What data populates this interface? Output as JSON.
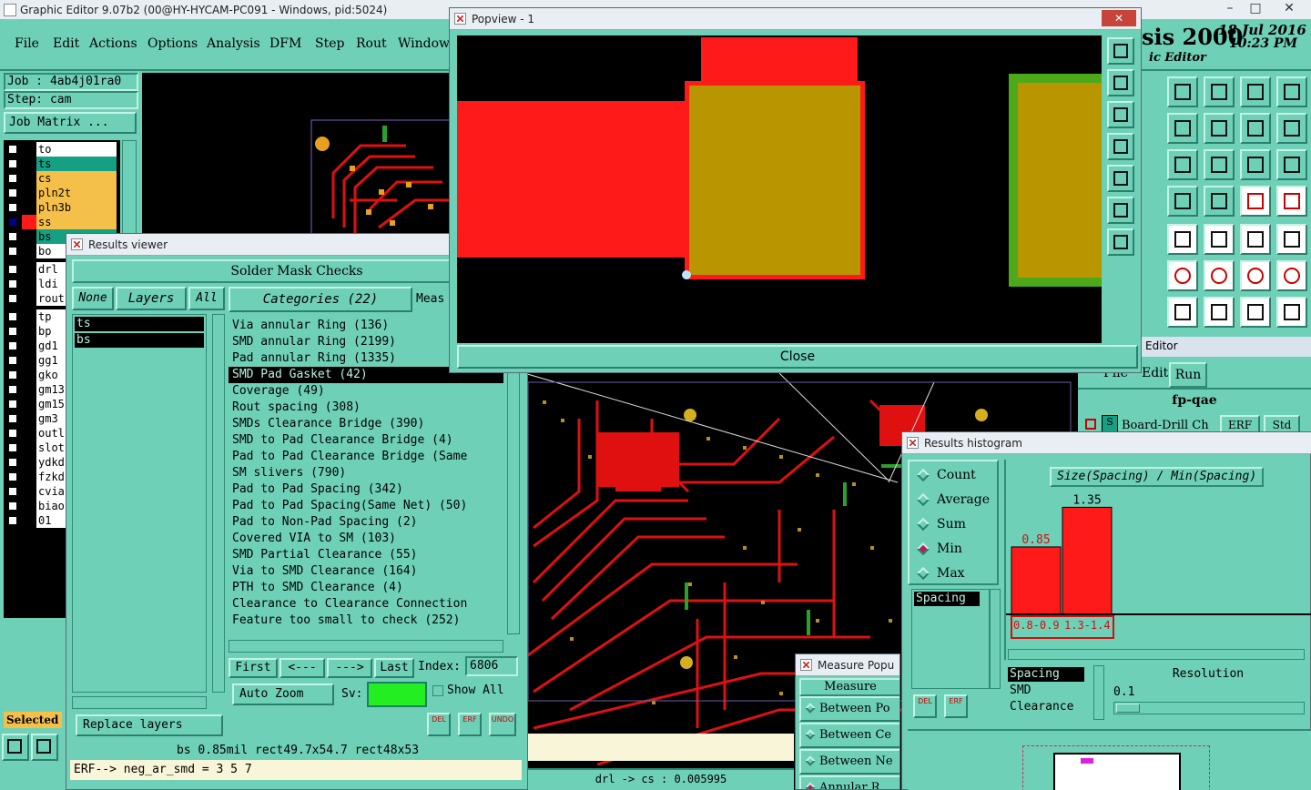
{
  "main_window": {
    "title": "Graphic Editor 9.07b2 (00@HY-HYCAM-PC091 - Windows, pid:5024)",
    "menu": [
      "File",
      "Edit",
      "Actions",
      "Options",
      "Analysis",
      "DFM",
      "Step",
      "Rout",
      "Windows"
    ],
    "job_label": "Job : 4ab4j01ra0",
    "step_label": "Step: cam",
    "job_matrix_button": "Job Matrix ...",
    "layers": [
      {
        "name": "to",
        "color": "#ffffff",
        "checked": false
      },
      {
        "name": "ts",
        "color": "#159f83",
        "checked": false
      },
      {
        "name": "cs",
        "color": "#f5c04a",
        "checked": false
      },
      {
        "name": "pln2t",
        "color": "#f5c04a",
        "checked": false
      },
      {
        "name": "pln3b",
        "color": "#f5c04a",
        "checked": false
      },
      {
        "name": "ss",
        "color": "#f5c04a",
        "checked": true
      },
      {
        "name": "bs",
        "color": "#159f83",
        "checked": false
      },
      {
        "name": "bo",
        "color": "#ffffff",
        "checked": false
      },
      {
        "name": "drl",
        "color": "#ffffff",
        "checked": false
      },
      {
        "name": "ldi",
        "color": "#ffffff",
        "checked": false
      },
      {
        "name": "rout",
        "color": "#ffffff",
        "checked": false
      },
      {
        "name": "tp",
        "color": "#ffffff",
        "checked": false
      },
      {
        "name": "bp",
        "color": "#ffffff",
        "checked": false
      },
      {
        "name": "gd1",
        "color": "#ffffff",
        "checked": false
      },
      {
        "name": "gg1",
        "color": "#ffffff",
        "checked": false
      },
      {
        "name": "gko",
        "color": "#ffffff",
        "checked": false
      },
      {
        "name": "gm13",
        "color": "#ffffff",
        "checked": false
      },
      {
        "name": "gm15",
        "color": "#ffffff",
        "checked": false
      },
      {
        "name": "gm3",
        "color": "#ffffff",
        "checked": false
      },
      {
        "name": "outl",
        "color": "#ffffff",
        "checked": false
      },
      {
        "name": "slot",
        "color": "#ffffff",
        "checked": false
      },
      {
        "name": "ydkd",
        "color": "#ffffff",
        "checked": false
      },
      {
        "name": "fzkd",
        "color": "#ffffff",
        "checked": false
      },
      {
        "name": "cvia",
        "color": "#ffffff",
        "checked": false
      },
      {
        "name": "biao",
        "color": "#ffffff",
        "checked": false
      },
      {
        "name": "01",
        "color": "#ffffff",
        "checked": false
      }
    ],
    "selected_label": "Selected",
    "brand": "sis 2000",
    "brand_sub": "ic Editor",
    "date": "18 Jul 2016",
    "time": "10:23 PM",
    "status_drl": "drl -> cs : 0.005995"
  },
  "results_viewer": {
    "title": "Results viewer",
    "heading": "Solder Mask Checks",
    "btn_none": "None",
    "btn_layers": "Layers",
    "btn_all": "All",
    "btn_categories": "Categories (22)",
    "btn_meas": "Meas",
    "layer_list": [
      "ts",
      "bs"
    ],
    "categories": [
      "Via annular Ring (136)",
      "SMD annular Ring (2199)",
      "Pad annular Ring (1335)",
      "SMD Pad Gasket (42)",
      "Coverage (49)",
      "Rout spacing (308)",
      "SMDs Clearance Bridge (390)",
      "SMD to Pad Clearance Bridge (4)",
      "Pad to Pad Clearance Bridge (Same",
      "SM slivers (790)",
      "Pad to Pad Spacing (342)",
      "Pad to Pad Spacing(Same Net) (50)",
      "Pad to Non-Pad Spacing (2)",
      "Covered VIA to SM (103)",
      "SMD Partial Clearance (55)",
      "Via to SMD Clearance (164)",
      "PTH to SMD Clearance (4)",
      "Clearance to Clearance Connection",
      "Feature too small to check (252)"
    ],
    "selected_category_index": 3,
    "nav_first": "First",
    "nav_prev": "<---",
    "nav_next": "--->",
    "nav_last": "Last",
    "index_label": "Index:",
    "index_value": "6806",
    "auto_zoom": "Auto Zoom",
    "sv_label": "Sv:",
    "show_all": "Show All",
    "replace_layers": "Replace layers",
    "del": "DEL",
    "erf": "ERF",
    "undo": "UNDO",
    "status_line": "bs 0.85mil  rect49.7x54.7  rect48x53",
    "erf_line": "ERF--> neg_ar_smd = 3 5 7"
  },
  "popview": {
    "title": "Popview - 1",
    "close": "Close"
  },
  "editor_panel": {
    "title": "Editor",
    "menu": [
      "File",
      "Edit",
      "Run"
    ],
    "heading": "fp-qae",
    "row_label": "Board-Drill Ch",
    "erf": "ERF",
    "std": "Std"
  },
  "results_histogram": {
    "title": "Results histogram",
    "options": [
      "Count",
      "Average",
      "Sum",
      "Min",
      "Max"
    ],
    "selected_option": "Min",
    "attr_list": [
      "Spacing"
    ],
    "chart_data": {
      "type": "bar",
      "title": "Size(Spacing) / Min(Spacing)",
      "categories": [
        "0.8-0.9",
        "1.3-1.4"
      ],
      "values": [
        0.85,
        1.35
      ],
      "ylim": [
        0,
        1.4
      ],
      "legend": "none",
      "bar_color": "#ff1a1a"
    },
    "measure_list": [
      "Spacing",
      "SMD",
      "Clearance"
    ],
    "resolution_label": "Resolution",
    "resolution_value": "0.1",
    "del": "DEL",
    "erf": "ERF"
  },
  "measure_popup": {
    "title": "Measure Popu",
    "heading": "Measure",
    "items": [
      "Between Po",
      "Between Ce",
      "Between Ne",
      "Annular R"
    ]
  }
}
